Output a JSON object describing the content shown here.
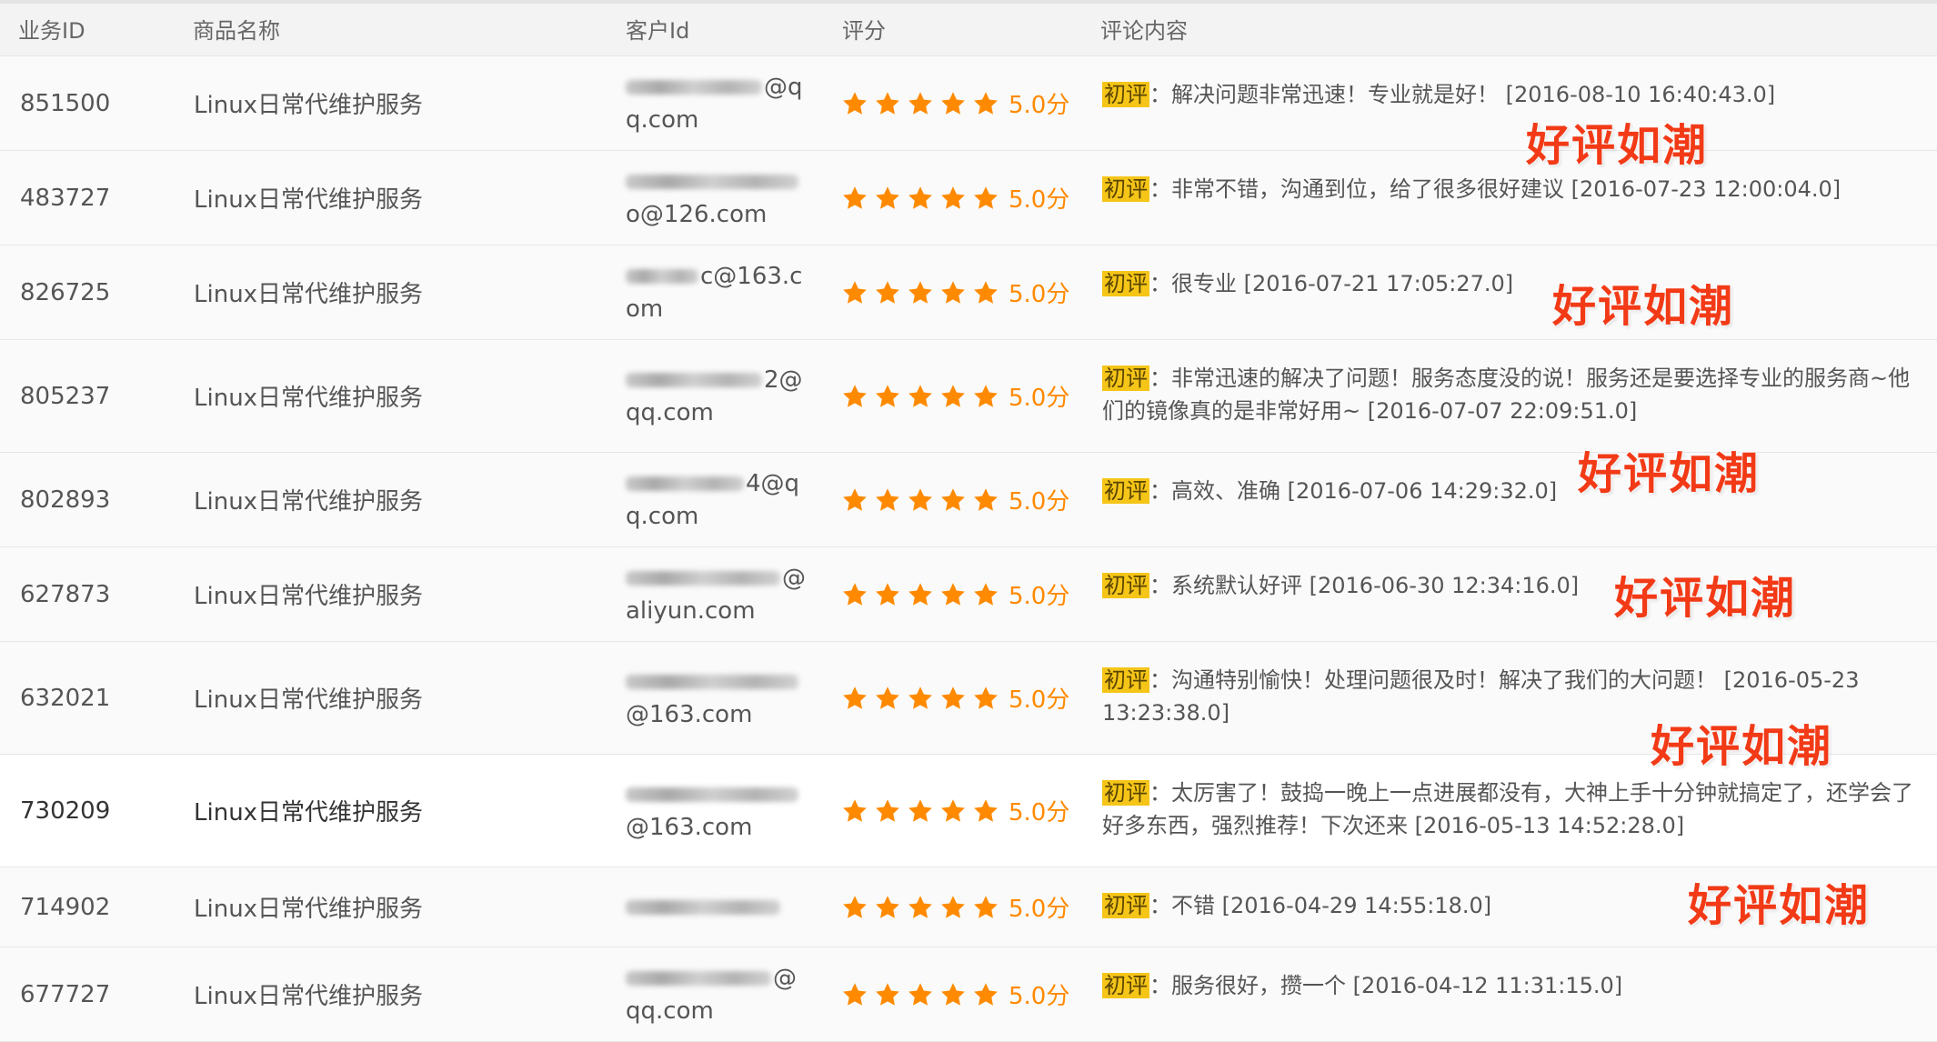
{
  "columns": {
    "id": "业务ID",
    "product": "商品名称",
    "customer": "客户Id",
    "rating": "评分",
    "comment": "评论内容"
  },
  "colors": {
    "star": "#ff8a00",
    "tag_bg": "#f5c518",
    "stamp": "#f23a17"
  },
  "rows": [
    {
      "id": "851500",
      "product": "Linux日常代维护服务",
      "customer_visible": "@qq.com",
      "score": "5.0分",
      "stars": 5,
      "tag": "初评",
      "comment": "：解决问题非常迅速！专业就是好！ [2016-08-10 16:40:43.0]"
    },
    {
      "id": "483727",
      "product": "Linux日常代维护服务",
      "customer_visible": "o@126.com",
      "score": "5.0分",
      "stars": 5,
      "tag": "初评",
      "comment": "：非常不错，沟通到位，给了很多很好建议 [2016-07-23 12:00:04.0]"
    },
    {
      "id": "826725",
      "product": "Linux日常代维护服务",
      "customer_visible": "c@163.com",
      "score": "5.0分",
      "stars": 5,
      "tag": "初评",
      "comment": "：很专业 [2016-07-21 17:05:27.0]"
    },
    {
      "id": "805237",
      "product": "Linux日常代维护服务",
      "customer_visible": "2@qq.com",
      "score": "5.0分",
      "stars": 5,
      "tag": "初评",
      "comment": "：非常迅速的解决了问题！服务态度没的说！服务还是要选择专业的服务商~他们的镜像真的是非常好用~ [2016-07-07 22:09:51.0]"
    },
    {
      "id": "802893",
      "product": "Linux日常代维护服务",
      "customer_visible": "4@qq.com",
      "score": "5.0分",
      "stars": 5,
      "tag": "初评",
      "comment": "：高效、准确 [2016-07-06 14:29:32.0]"
    },
    {
      "id": "627873",
      "product": "Linux日常代维护服务",
      "customer_visible": "@aliyun.com",
      "score": "5.0分",
      "stars": 5,
      "tag": "初评",
      "comment": "：系统默认好评 [2016-06-30 12:34:16.0]"
    },
    {
      "id": "632021",
      "product": "Linux日常代维护服务",
      "customer_visible": "@163.com",
      "score": "5.0分",
      "stars": 5,
      "tag": "初评",
      "comment": "：沟通特别愉快！处理问题很及时！解决了我们的大问题！ [2016-05-23 13:23:38.0]"
    },
    {
      "id": "730209",
      "product": "Linux日常代维护服务",
      "customer_visible": "@163.com",
      "score": "5.0分",
      "stars": 5,
      "tag": "初评",
      "comment": "：太厉害了！鼓捣一晚上一点进展都没有，大神上手十分钟就搞定了，还学会了好多东西，强烈推荐！下次还来 [2016-05-13 14:52:28.0]"
    },
    {
      "id": "714902",
      "product": "Linux日常代维护服务",
      "customer_visible": "",
      "score": "5.0分",
      "stars": 5,
      "tag": "初评",
      "comment": "：不错 [2016-04-29 14:55:18.0]"
    },
    {
      "id": "677727",
      "product": "Linux日常代维护服务",
      "customer_visible": "@qq.com",
      "score": "5.0分",
      "stars": 5,
      "tag": "初评",
      "comment": "：服务很好，攒一个 [2016-04-12 11:31:15.0]"
    }
  ],
  "stamps": [
    "好评如潮",
    "好评如潮",
    "好评如潮",
    "好评如潮",
    "好评如潮",
    "好评如潮"
  ]
}
